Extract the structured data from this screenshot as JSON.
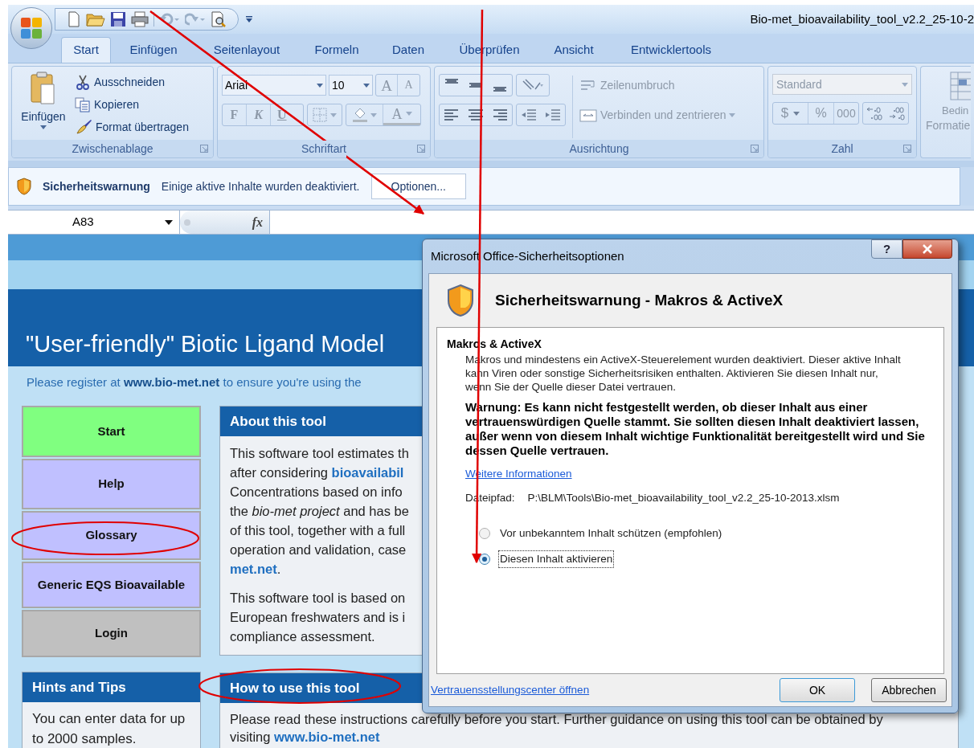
{
  "title_bar": {
    "title": "Bio-met_bioavailability_tool_v2.2_25-10-2"
  },
  "ribbon_tabs": [
    {
      "label": "Start",
      "selected": true
    },
    {
      "label": "Einfügen",
      "selected": false
    },
    {
      "label": "Seitenlayout",
      "selected": false
    },
    {
      "label": "Formeln",
      "selected": false
    },
    {
      "label": "Daten",
      "selected": false
    },
    {
      "label": "Überprüfen",
      "selected": false
    },
    {
      "label": "Ansicht",
      "selected": false
    },
    {
      "label": "Entwicklertools",
      "selected": false
    }
  ],
  "ribbon": {
    "clipboard": {
      "label": "Zwischenablage",
      "disabled": false,
      "paste": "Einfügen",
      "cut": "Ausschneiden",
      "copy": "Kopieren",
      "format_painter": "Format übertragen"
    },
    "font": {
      "label": "Schriftart",
      "disabled": true,
      "name": "Arial",
      "size": "10",
      "grow": "A",
      "shrink": "A",
      "bold": "F",
      "italic": "K",
      "underline": "U",
      "font_color": "A"
    },
    "alignment": {
      "label": "Ausrichtung",
      "disabled": true,
      "wrap": "Zeilenumbruch",
      "merge": "Verbinden und zentrieren"
    },
    "number": {
      "label": "Zahl",
      "disabled": true,
      "format": "Standard",
      "currency": "$",
      "percent": "%",
      "thousands": "000"
    },
    "styles": {
      "line_1": "Bedin",
      "line_2": "Formatie"
    }
  },
  "security_bar": {
    "title": "Sicherheitswarnung",
    "message": "Einige aktive Inhalte wurden deaktiviert.",
    "button": "Optionen..."
  },
  "formula_bar": {
    "name_box": "A83",
    "function_label": "fx"
  },
  "sheet": {
    "banner_title": "\"User-friendly\" Biotic Ligand Model",
    "register_note": "Please register at **www.bio-met.net** to ensure you're using the",
    "nav_buttons": [
      {
        "label": "Start",
        "color": "#80ff80"
      },
      {
        "label": "Help",
        "color": "#c0c0ff"
      },
      {
        "label": "Glossary",
        "color": "#c0c0ff"
      },
      {
        "label": "Generic EQS Bioavailable",
        "color": "#c0c0ff"
      },
      {
        "label": "Login",
        "color": "#c0c0c0"
      }
    ],
    "about": {
      "title": "About this tool",
      "paragraphs": [
        [
          "This software tool estimates th",
          "after considering **bioavailabil**",
          "Concentrations based on info",
          "the *bio-met project* and has be",
          "of this tool, together with a full",
          "operation and validation, case",
          "**met.net**."
        ],
        [
          "This software tool is based on",
          "European freshwaters and is i",
          "compliance assessment."
        ]
      ]
    },
    "hints": {
      "title": "Hints and Tips",
      "text": "You can enter data for up to 2000 samples."
    },
    "how_to": {
      "title": "How to use this tool",
      "text": "Please read these instructions carefully before you start. Further guidance on using this tool can be obtained by visiting **www.bio-met.net**"
    }
  },
  "dialog": {
    "title": "Microsoft Office-Sicherheitsoptionen",
    "help": "?",
    "heading": "Sicherheitswarnung - Makros & ActiveX",
    "section_title": "Makros & ActiveX",
    "description": "Makros und mindestens ein ActiveX-Steuerelement wurden deaktiviert. Dieser aktive Inhalt kann Viren oder sonstige Sicherheitsrisiken enthalten. Aktivieren Sie diesen Inhalt nur, wenn Sie der Quelle dieser Datei vertrauen.",
    "warning": "Warnung: Es kann nicht festgestellt werden, ob dieser Inhalt aus einer vertrauenswürdigen Quelle stammt. Sie sollten diesen Inhalt deaktiviert lassen, außer wenn von diesem Inhalt wichtige Funktionalität bereitgestellt wird und Sie dessen Quelle vertrauen.",
    "more_info_link": "Weitere Informationen",
    "file_path_label": "Dateipfad:",
    "file_path": "P:\\BLM\\Tools\\Bio-met_bioavailability_tool_v2.2_25-10-2013.xlsm",
    "options": [
      {
        "label": "Vor unbekanntem Inhalt schützen (empfohlen)",
        "selected": false
      },
      {
        "label": "Diesen Inhalt aktivieren",
        "selected": true
      }
    ],
    "trust_center_link": "Vertrauensstellungscenter öffnen",
    "buttons": [
      "OK",
      "Abbrechen"
    ]
  }
}
